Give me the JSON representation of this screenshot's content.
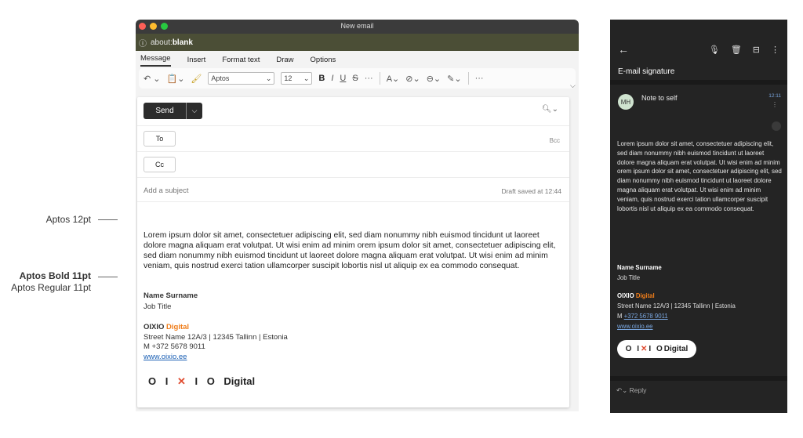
{
  "annotations": {
    "regular12": "Aptos 12pt",
    "bold11": "Aptos Bold 11pt",
    "regular11": "Aptos Regular 11pt"
  },
  "window": {
    "title": "New email",
    "address_prefix": "about:",
    "address_bold": "blank",
    "info_icon": "info-icon",
    "traffic_colors": [
      "#ff5f57",
      "#febc2e",
      "#28c840"
    ]
  },
  "menu": [
    "Message",
    "Insert",
    "Format text",
    "Draw",
    "Options"
  ],
  "toolbar": {
    "font_name": "Aptos",
    "font_size": "12",
    "more": "···"
  },
  "compose": {
    "send_label": "Send",
    "to_label": "To",
    "cc_label": "Cc",
    "bcc_label": "Bcc",
    "subject_placeholder": "Add a subject",
    "draft_status": "Draft saved at 12:44",
    "body": "Lorem ipsum dolor sit amet, consectetuer adipiscing elit, sed diam nonummy nibh euismod tincidunt ut laoreet dolore magna aliquam erat volutpat. Ut wisi enim ad minim orem ipsum dolor sit amet, consectetuer adipiscing elit, sed diam nonummy nibh euismod tincidunt ut laoreet dolore magna aliquam erat volutpat. Ut wisi enim ad minim veniam, quis nostrud exerci tation ullamcorper suscipit lobortis nisl ut aliquip ex ea commodo consequat."
  },
  "signature": {
    "name": "Name Surname",
    "title": "Job Title",
    "org_primary": "OIXIO",
    "org_accent": "Digital",
    "address": "Street Name 12A/3 | 12345 Tallinn | Estonia",
    "mobile": "M +372 5678 9011",
    "mobile_prefix": "M ",
    "mobile_number": "+372 5678 9011",
    "website": "www.oixio.ee",
    "logo_text": "OIXIO Digital",
    "accent_color": "#ef7d1a"
  },
  "mobile": {
    "subject": "E-mail signature",
    "avatar_initials": "MH",
    "sender": "Note to self",
    "time": "12:11",
    "reply_label": "Reply"
  }
}
